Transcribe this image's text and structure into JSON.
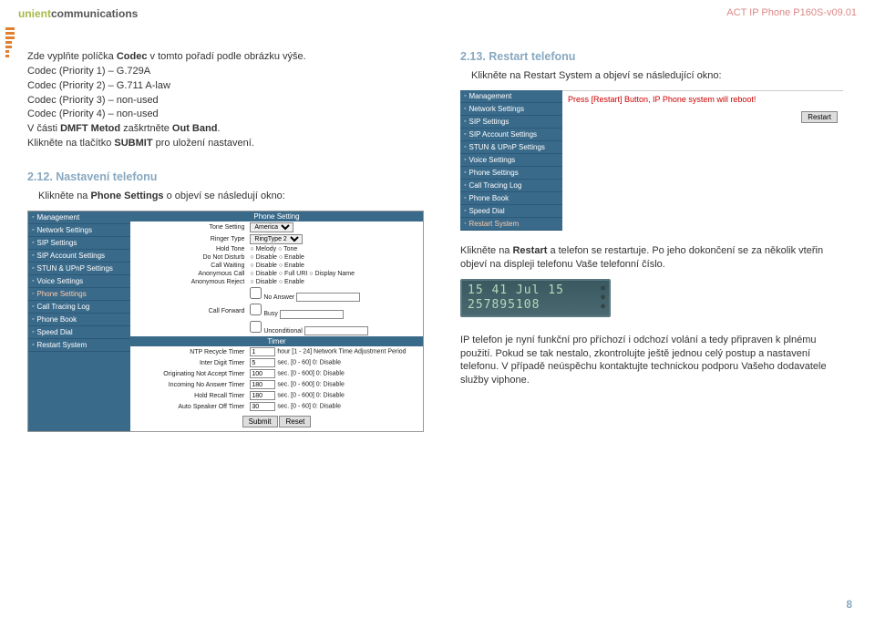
{
  "header": {
    "logo_light": "unient",
    "logo_dark": "communications",
    "doc_id": "ACT IP Phone P160S-v09.01"
  },
  "left": {
    "intro": [
      "Zde vyplňte políčka <b>Codec</b> v tomto pořadí podle obrázku výše.",
      "Codec (Priority 1) – G.729A",
      "Codec (Priority 2) – G.711 A-law",
      "Codec (Priority 3) – non-used",
      "Codec (Priority 4) – non-used",
      "V části <b>DMFT Metod</b> zaškrtněte <b>Out Band</b>.",
      "Klikněte na tlačítko <b>SUBMIT</b> pro uložení nastavení."
    ],
    "sec12_title": "2.12. Nastavení telefonu",
    "sec12_body": "Klikněte na <b>Phone Settings</b> o objeví se následují okno:",
    "sidebar": [
      "Management",
      "Network Settings",
      "SIP Settings",
      "SIP Account Settings",
      "STUN & UPnP Settings",
      "Voice Settings",
      "Phone Settings",
      "Call Tracing Log",
      "Phone Book",
      "Speed Dial",
      "Restart System"
    ],
    "sidebar_active": "Phone Settings",
    "phone_setting": {
      "hdr": "Phone Setting",
      "rows": [
        {
          "lbl": "Tone Setting",
          "type": "select",
          "val": "America"
        },
        {
          "lbl": "Ringer Type",
          "type": "select",
          "val": "RingType 2"
        },
        {
          "lbl": "Hold Tone",
          "type": "radio",
          "opts": [
            "Melody",
            "Tone"
          ]
        },
        {
          "lbl": "Do Not Disturb",
          "type": "radio",
          "opts": [
            "Disable",
            "Enable"
          ]
        },
        {
          "lbl": "Call Waiting",
          "type": "radio",
          "opts": [
            "Disable",
            "Enable"
          ]
        },
        {
          "lbl": "Anonymous Call",
          "type": "radio",
          "opts": [
            "Disable",
            "Full URI",
            "Display Name"
          ]
        },
        {
          "lbl": "Anonymous Reject",
          "type": "radio",
          "opts": [
            "Disable",
            "Enable"
          ]
        },
        {
          "lbl": "",
          "type": "text-plain",
          "val": "No Answer"
        },
        {
          "lbl": "Call Forward",
          "type": "text-plain",
          "val": "Busy"
        },
        {
          "lbl": "",
          "type": "text-plain",
          "val": "Unconditional"
        }
      ]
    },
    "timer": {
      "hdr": "Timer",
      "rows": [
        {
          "lbl": "NTP Recycle Timer",
          "val": "1",
          "suffix": "hour [1 - 24]  Network Time Adjustment Period"
        },
        {
          "lbl": "Inter Digit Timer",
          "val": "5",
          "suffix": "sec. [0 - 60] 0: Disable"
        },
        {
          "lbl": "Originating Not Accept Timer",
          "val": "100",
          "suffix": "sec. [0 - 600] 0: Disable"
        },
        {
          "lbl": "Incoming No Answer Timer",
          "val": "180",
          "suffix": "sec. [0 - 600] 0: Disable"
        },
        {
          "lbl": "Hold Recall Timer",
          "val": "180",
          "suffix": "sec. [0 - 600] 0: Disable"
        },
        {
          "lbl": "Auto Speaker Off Timer",
          "val": "30",
          "suffix": "sec. [0 - 60] 0: Disable"
        }
      ]
    },
    "buttons": {
      "submit": "Submit",
      "reset": "Reset"
    }
  },
  "right": {
    "sec13_title": "2.13. Restart telefonu",
    "sec13_body": "Klikněte na Restart System a objeví se následující okno:",
    "sidebar_active": "Restart System",
    "restart_msg": "Press [Restart] Button, IP Phone system will reboot!",
    "restart_btn": "Restart",
    "after_restart": "Klikněte na <b>Restart</b> a telefon se restartuje. Po jeho dokončení se za několik vteřin objeví na displeji telefonu Vaše telefonní číslo.",
    "display_line1": "15 41    Jul 15",
    "display_line2": "257895108",
    "final": "IP telefon je nyní funkční pro příchozí i odchozí volání a tedy připraven k plnému použití. Pokud se tak nestalo, zkontrolujte ještě jednou celý postup a nastavení telefonu. V případě neúspěchu kontaktujte technickou podporu Vašeho dodavatele služby viphone."
  },
  "page_number": "8"
}
